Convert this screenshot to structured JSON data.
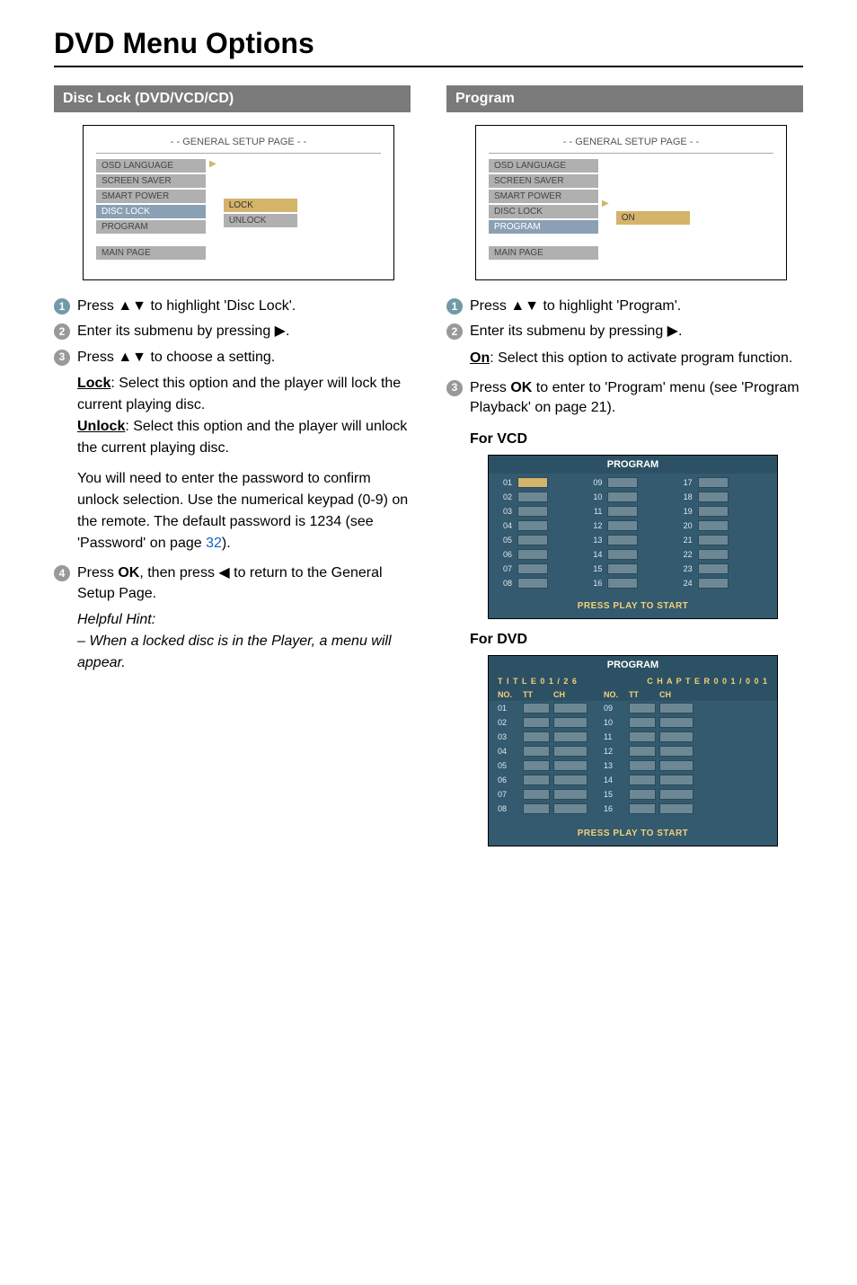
{
  "page_title": "DVD Menu Options",
  "left": {
    "section_title": "Disc Lock (DVD/VCD/CD)",
    "osd": {
      "header": "- - GENERAL SETUP PAGE - -",
      "items": [
        "OSD LANGUAGE",
        "SCREEN SAVER",
        "SMART POWER",
        "DISC LOCK",
        "PROGRAM"
      ],
      "highlight_index": 3,
      "sub_items": [
        "LOCK",
        "UNLOCK"
      ],
      "sub_active_index": 0,
      "main_page": "MAIN PAGE"
    },
    "step1": "Press ▲▼ to highlight 'Disc Lock'.",
    "step2": "Enter its submenu by pressing ▶.",
    "step3_lead": "Press ▲▼ to choose a setting.",
    "lock_label": "Lock",
    "lock_text": ": Select this option and the player will lock the current playing disc.",
    "unlock_label": "Unlock",
    "unlock_text": ": Select this option and the player will unlock the current playing disc.",
    "password_block_1": "You will need to enter the password to confirm unlock selection.  Use the numerical keypad (0-9) on the remote. The default password is 1234 (see 'Password' on page ",
    "password_pagenum": "32",
    "password_block_2": ").",
    "step4_pre": "Press ",
    "step4_ok": "OK",
    "step4_mid": ", then press ◀ to return to the General Setup Page.",
    "hint_heading": "Helpful Hint:",
    "hint_text": "–   When a locked disc is in the Player, a menu will appear."
  },
  "right": {
    "section_title": "Program",
    "osd": {
      "header": "- - GENERAL SETUP PAGE - -",
      "items": [
        "OSD LANGUAGE",
        "SCREEN SAVER",
        "SMART POWER",
        "DISC LOCK",
        "PROGRAM"
      ],
      "highlight_index": 4,
      "sub_items": [
        "ON"
      ],
      "sub_active_index": 0,
      "main_page": "MAIN PAGE"
    },
    "step1": "Press ▲▼ to highlight 'Program'.",
    "step2": "Enter its submenu by pressing ▶.",
    "on_label": "On",
    "on_text": ": Select this option to activate program function.",
    "step3_pre": "Press ",
    "step3_ok": "OK",
    "step3_post": " to enter to 'Program' menu (see 'Program Playback' on page 21).",
    "vcd_heading": "For VCD",
    "dvd_heading": "For DVD",
    "prog_title": "PROGRAM",
    "prog_footer": "PRESS PLAY TO START",
    "dvd_title_left": "T I T L E 0 1 / 2 6",
    "dvd_title_right": "C H A P T E R 0 0 1 / 0 0 1",
    "dvd_colhead": {
      "no": "NO.",
      "tt": "TT",
      "ch": "CH"
    },
    "vcd_numbers_col1": [
      "01",
      "02",
      "03",
      "04",
      "05",
      "06",
      "07",
      "08"
    ],
    "vcd_numbers_col2": [
      "09",
      "10",
      "11",
      "12",
      "13",
      "14",
      "15",
      "16"
    ],
    "vcd_numbers_col3": [
      "17",
      "18",
      "19",
      "20",
      "21",
      "22",
      "23",
      "24"
    ],
    "dvd_rows_left": [
      "01",
      "02",
      "03",
      "04",
      "05",
      "06",
      "07",
      "08"
    ],
    "dvd_rows_right": [
      "09",
      "10",
      "11",
      "12",
      "13",
      "14",
      "15",
      "16"
    ]
  }
}
